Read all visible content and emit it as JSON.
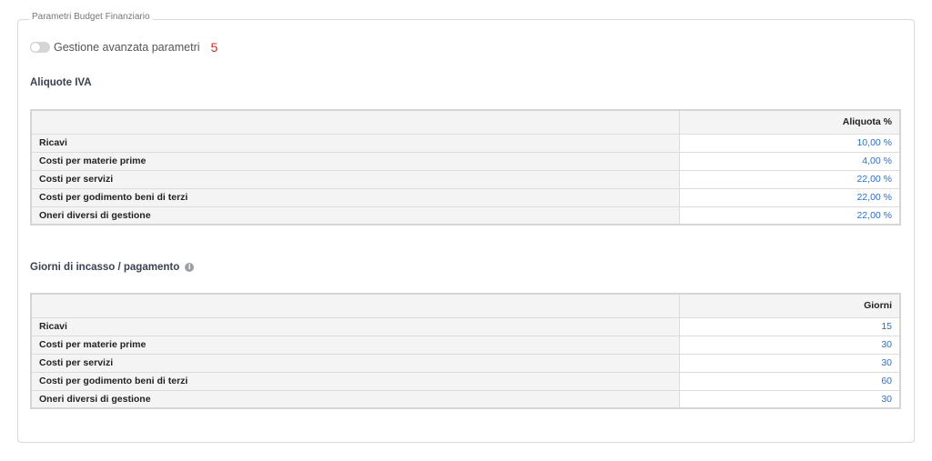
{
  "fieldset": {
    "legend": "Parametri Budget Finanziario"
  },
  "toggle": {
    "label": "Gestione avanzata parametri",
    "note": "5",
    "enabled": false
  },
  "iva": {
    "title": "Aliquote IVA",
    "header": {
      "label": "",
      "value": "Aliquota %"
    },
    "rows": [
      {
        "label": "Ricavi",
        "value": "10,00 %"
      },
      {
        "label": "Costi per materie prime",
        "value": "4,00 %"
      },
      {
        "label": "Costi per servizi",
        "value": "22,00 %"
      },
      {
        "label": "Costi per godimento beni di terzi",
        "value": "22,00 %"
      },
      {
        "label": "Oneri diversi di gestione",
        "value": "22,00 %"
      }
    ]
  },
  "giorni": {
    "title": "Giorni di incasso / pagamento",
    "info_icon": "info-icon",
    "header": {
      "label": "",
      "value": "Giorni"
    },
    "rows": [
      {
        "label": "Ricavi",
        "value": "15"
      },
      {
        "label": "Costi per materie prime",
        "value": "30"
      },
      {
        "label": "Costi per servizi",
        "value": "30"
      },
      {
        "label": "Costi per godimento beni di terzi",
        "value": "60"
      },
      {
        "label": "Oneri diversi di gestione",
        "value": "30"
      }
    ]
  },
  "colors": {
    "link_value": "#2a6fc9",
    "note": "#e02020",
    "header_bg": "#f4f4f4"
  }
}
